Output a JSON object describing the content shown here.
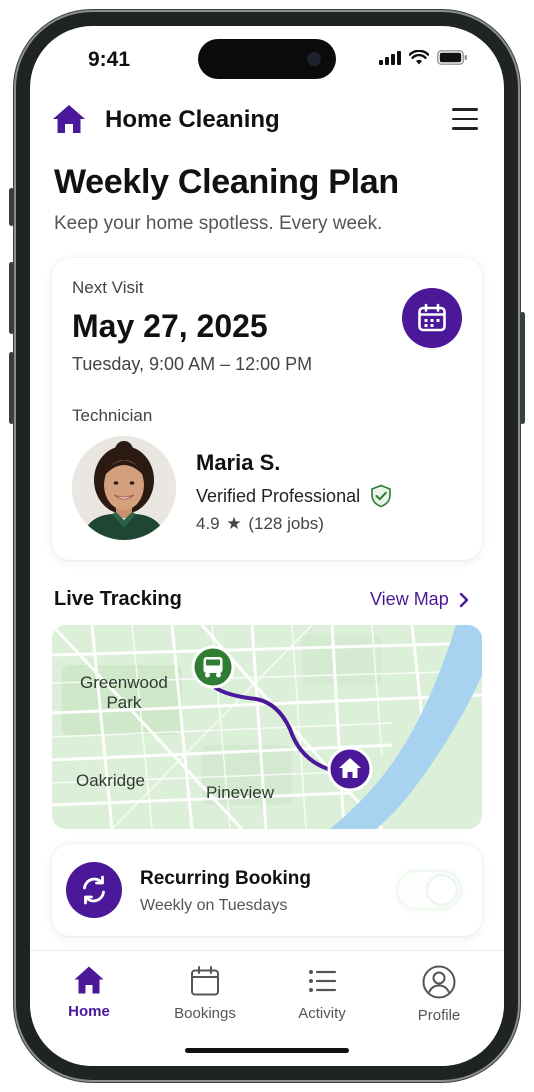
{
  "status_bar": {
    "time": "9:41"
  },
  "header": {
    "app_title": "Home Cleaning",
    "logo_icon": "home-icon",
    "menu_icon": "hamburger-menu-icon"
  },
  "page": {
    "title": "Weekly Cleaning Plan",
    "subtitle": "Keep your home spotless. Every week."
  },
  "next_visit": {
    "label": "Next Visit",
    "date": "May 27, 2025",
    "time": "Tuesday, 9:00 AM – 12:00 PM",
    "icon": "calendar-icon"
  },
  "technician": {
    "label": "Technician",
    "name": "Maria S.",
    "verified": "Verified Professional",
    "rating": "4.9",
    "jobs": "(128 jobs)"
  },
  "tracking": {
    "title": "Live Tracking",
    "view_map": "View Map",
    "places": [
      "Greenwood Park",
      "Oakridge",
      "Pineview"
    ]
  },
  "recurring": {
    "title": "Recurring Booking",
    "subtitle": "Weekly on Tuesdays",
    "enabled": true,
    "icon": "sync-icon"
  },
  "tabs": [
    {
      "label": "Home",
      "icon": "home-icon",
      "active": true
    },
    {
      "label": "Bookings",
      "icon": "calendar-icon",
      "active": false
    },
    {
      "label": "Activity",
      "icon": "list-icon",
      "active": false
    },
    {
      "label": "Profile",
      "icon": "user-icon",
      "active": false
    }
  ],
  "colors": {
    "accent": "#4a1899",
    "success": "#2e7d32",
    "water": "#a7d3f0",
    "map_land": "#dcefd8"
  }
}
